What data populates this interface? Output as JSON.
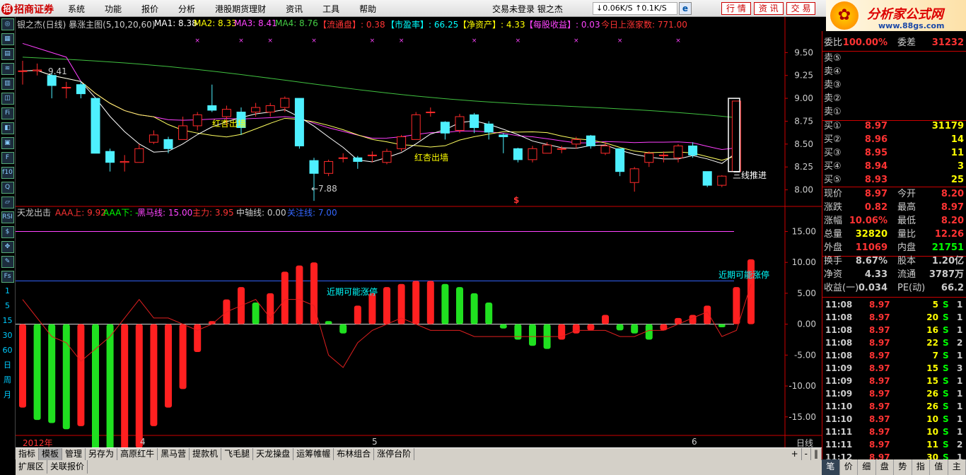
{
  "titlebar": {
    "app_name": "招商证券",
    "menu": [
      "系统",
      "功能",
      "报价",
      "分析",
      "港股期货理财",
      "资讯",
      "工具",
      "帮助"
    ],
    "status": "交易未登录  银之杰",
    "speed": "↓0.06K/S  ↑0.1K/S",
    "buttons": [
      "行 情",
      "资 讯",
      "交 易"
    ]
  },
  "brand": {
    "title": "分析家公式网",
    "url": "www.88gs.com"
  },
  "left_toolbar": [
    "◎",
    "▦",
    "▤",
    "≋",
    "▥",
    "◫",
    "Fi",
    "◧",
    "▣",
    "F",
    "f10",
    "Q",
    "▱",
    "RSI",
    "$",
    "✥",
    "✎",
    "Fs",
    "1",
    "5",
    "15",
    "30",
    "60",
    "日",
    "周",
    "月"
  ],
  "main_chart": {
    "header": {
      "name": "银之杰(日线)  暴涨主图(5,10,20,60)",
      "ma1": "MA1: 8.38",
      "ma2": "MA2: 8.33",
      "ma3": "MA3: 8.41",
      "ma4": "MA4: 8.76",
      "f1": "【流通盘】: 0.38",
      "f2": "【市盈率】: 66.25",
      "f3": "【净资产】: 4.33",
      "f4": "【每股收益】: 0.03",
      "f5": "今日上涨家数: 771.00"
    },
    "y_ticks": [
      "9.50",
      "9.25",
      "9.00",
      "8.75",
      "8.50",
      "8.25",
      "8.00"
    ],
    "annotations": {
      "high": "9.41",
      "low": "←7.88",
      "hx1": "红杏出墙",
      "hx2": "红杏出墙",
      "sxtj": "三线推进",
      "dollar": "$"
    },
    "colors": {
      "up": "#ff2a2a",
      "down": "#4ef0ff",
      "ma5": "#ffffff",
      "ma10": "#ffff60",
      "ma20": "#ff40ff",
      "ma60": "#40c040"
    }
  },
  "sub_chart": {
    "header": {
      "name": "天龙出击",
      "aaa_up": "AAA上: 9.92",
      "aaa_down": "AAA下: -",
      "hmx": "黑马线: 15.00",
      "zl": "主力: 3.95",
      "zzx": "中轴线: 0.00",
      "gzx": "关注线: 7.00"
    },
    "y_ticks": [
      "15.00",
      "10.00",
      "5.00",
      "0.00",
      "-5.00",
      "-10.00",
      "-15.00"
    ],
    "labels": {
      "a": "近期可能涨停",
      "b": "近期可能涨停"
    },
    "axis": {
      "year": "2012年",
      "m4": "4",
      "m5": "5",
      "m6": "6",
      "period": "日线"
    }
  },
  "chart_data": [
    {
      "type": "candlestick",
      "title": "银之杰(日线) 暴涨主图(5,10,20,60)",
      "ylim": [
        7.85,
        9.75
      ],
      "candles": [
        {
          "o": 9.3,
          "c": 9.3,
          "h": 9.41,
          "l": 9.15
        },
        {
          "o": 9.3,
          "c": 9.31,
          "h": 9.38,
          "l": 9.25
        },
        {
          "o": 9.25,
          "c": 9.14,
          "h": 9.28,
          "l": 9.0
        },
        {
          "o": 9.12,
          "c": 9.12,
          "h": 9.18,
          "l": 9.0
        },
        {
          "o": 9.15,
          "c": 9.05,
          "h": 9.18,
          "l": 9.0
        },
        {
          "o": 9.0,
          "c": 8.4,
          "h": 9.0,
          "l": 8.4
        },
        {
          "o": 8.42,
          "c": 8.3,
          "h": 8.45,
          "l": 8.2
        },
        {
          "o": 8.3,
          "c": 8.31,
          "h": 8.38,
          "l": 8.2
        },
        {
          "o": 8.3,
          "c": 8.45,
          "h": 8.5,
          "l": 8.3
        },
        {
          "o": 8.52,
          "c": 8.6,
          "h": 8.65,
          "l": 8.5
        },
        {
          "o": 8.55,
          "c": 8.45,
          "h": 8.58,
          "l": 8.4
        },
        {
          "o": 8.55,
          "c": 8.7,
          "h": 8.8,
          "l": 8.55
        },
        {
          "o": 8.7,
          "c": 8.82,
          "h": 8.85,
          "l": 8.65
        },
        {
          "o": 8.92,
          "c": 8.87,
          "h": 9.15,
          "l": 8.85
        },
        {
          "o": 8.8,
          "c": 8.88,
          "h": 8.92,
          "l": 8.7
        },
        {
          "o": 8.85,
          "c": 8.68,
          "h": 8.9,
          "l": 8.6
        },
        {
          "o": 8.85,
          "c": 8.9,
          "h": 8.95,
          "l": 8.8
        },
        {
          "o": 8.85,
          "c": 8.92,
          "h": 8.95,
          "l": 8.8
        },
        {
          "o": 8.9,
          "c": 9.0,
          "h": 9.02,
          "l": 8.85
        },
        {
          "o": 9.0,
          "c": 8.48,
          "h": 9.0,
          "l": 8.45
        },
        {
          "o": 8.32,
          "c": 8.18,
          "h": 8.35,
          "l": 7.88
        },
        {
          "o": 8.18,
          "c": 8.31,
          "h": 8.33,
          "l": 8.15
        },
        {
          "o": 8.35,
          "c": 8.35,
          "h": 8.4,
          "l": 8.3
        },
        {
          "o": 8.35,
          "c": 8.31,
          "h": 8.37,
          "l": 8.23
        },
        {
          "o": 8.38,
          "c": 8.38,
          "h": 8.42,
          "l": 8.3
        },
        {
          "o": 8.3,
          "c": 8.42,
          "h": 8.45,
          "l": 8.28
        },
        {
          "o": 8.45,
          "c": 8.58,
          "h": 8.6,
          "l": 8.42
        },
        {
          "o": 8.55,
          "c": 8.82,
          "h": 8.85,
          "l": 8.55
        },
        {
          "o": 8.85,
          "c": 8.85,
          "h": 8.9,
          "l": 8.8
        },
        {
          "o": 8.74,
          "c": 8.62,
          "h": 8.75,
          "l": 8.55
        },
        {
          "o": 8.65,
          "c": 8.8,
          "h": 8.83,
          "l": 8.62
        },
        {
          "o": 8.82,
          "c": 8.68,
          "h": 8.84,
          "l": 8.62
        },
        {
          "o": 8.72,
          "c": 8.63,
          "h": 8.75,
          "l": 8.55
        },
        {
          "o": 8.6,
          "c": 8.58,
          "h": 8.62,
          "l": 8.4
        },
        {
          "o": 8.45,
          "c": 8.33,
          "h": 8.46,
          "l": 8.3
        },
        {
          "o": 8.33,
          "c": 8.45,
          "h": 8.48,
          "l": 8.3
        },
        {
          "o": 8.4,
          "c": 8.49,
          "h": 8.52,
          "l": 8.4
        },
        {
          "o": 8.45,
          "c": 8.45,
          "h": 8.48,
          "l": 8.4
        },
        {
          "o": 8.5,
          "c": 8.55,
          "h": 8.58,
          "l": 8.45
        },
        {
          "o": 8.59,
          "c": 8.48,
          "h": 8.6,
          "l": 8.45
        },
        {
          "o": 8.4,
          "c": 8.48,
          "h": 8.52,
          "l": 8.38
        },
        {
          "o": 8.45,
          "c": 8.2,
          "h": 8.45,
          "l": 8.15
        },
        {
          "o": 8.08,
          "c": 8.23,
          "h": 8.25,
          "l": 7.98
        },
        {
          "o": 8.3,
          "c": 8.4,
          "h": 8.42,
          "l": 8.25
        },
        {
          "o": 8.38,
          "c": 8.38,
          "h": 8.42,
          "l": 8.3
        },
        {
          "o": 8.35,
          "c": 8.48,
          "h": 8.5,
          "l": 8.3
        },
        {
          "o": 8.48,
          "c": 8.38,
          "h": 8.52,
          "l": 8.35
        },
        {
          "o": 8.2,
          "c": 8.05,
          "h": 8.2,
          "l": 8.03
        },
        {
          "o": 8.05,
          "c": 8.15,
          "h": 8.16,
          "l": 8.03
        },
        {
          "o": 8.2,
          "c": 8.97,
          "h": 8.97,
          "l": 8.2
        }
      ]
    },
    {
      "type": "bar",
      "title": "天龙出击",
      "ylim": [
        -18,
        17
      ],
      "values": [
        -13.5,
        -15.5,
        -16,
        -17,
        -16.5,
        -23.5,
        -24,
        -23,
        -20,
        -16.5,
        -13.5,
        -10.5,
        -4.5,
        0.5,
        4,
        6,
        3.5,
        5,
        8.5,
        9.5,
        10,
        0.5,
        -1.5,
        3,
        5,
        6,
        6.5,
        7,
        7,
        6.5,
        6,
        5,
        3.5,
        -0.7,
        -2.5,
        -3.5,
        -4,
        -2.5,
        -1.5,
        -1,
        1.5,
        -1,
        -1.5,
        -2.5,
        -1,
        1,
        1.5,
        3,
        -0.5,
        6,
        10.5
      ],
      "line": [
        4,
        1,
        -2,
        -3,
        -6,
        -4,
        -2,
        1,
        4,
        1,
        1,
        0,
        -1,
        0,
        2,
        3,
        4,
        1,
        4,
        4,
        3,
        -5,
        -7,
        -3,
        -1,
        0,
        1,
        0,
        -1,
        -1,
        -1,
        -2,
        -2,
        -2,
        -2,
        -2,
        -2,
        -2,
        -1,
        -1,
        -1,
        -2,
        -2,
        -1,
        -1,
        0,
        1,
        2,
        -2,
        -1,
        6.5
      ],
      "series": [
        {
          "name": "黑马线",
          "value": 15
        },
        {
          "name": "关注线",
          "value": 7
        },
        {
          "name": "中轴线",
          "value": 0
        }
      ]
    }
  ],
  "quote": {
    "wb": {
      "label": "委比",
      "value": "100.00%",
      "label2": "委差",
      "value2": "31232"
    },
    "sells": [
      {
        "label": "卖⑤"
      },
      {
        "label": "卖④"
      },
      {
        "label": "卖③"
      },
      {
        "label": "卖②"
      },
      {
        "label": "卖①"
      }
    ],
    "buys": [
      {
        "label": "买①",
        "price": "8.97",
        "vol": "31179"
      },
      {
        "label": "买②",
        "price": "8.96",
        "vol": "14"
      },
      {
        "label": "买③",
        "price": "8.95",
        "vol": "11"
      },
      {
        "label": "买④",
        "price": "8.94",
        "vol": "3"
      },
      {
        "label": "买⑤",
        "price": "8.93",
        "vol": "25"
      }
    ],
    "stats": [
      {
        "k1": "现价",
        "v1": "8.97",
        "k2": "今开",
        "v2": "8.20"
      },
      {
        "k1": "涨跌",
        "v1": "0.82",
        "k2": "最高",
        "v2": "8.97"
      },
      {
        "k1": "涨幅",
        "v1": "10.06%",
        "k2": "最低",
        "v2": "8.20"
      },
      {
        "k1": "总量",
        "v1": "32820",
        "k2": "量比",
        "v2": "12.26"
      },
      {
        "k1": "外盘",
        "v1": "11069",
        "k2": "内盘",
        "v2": "21751"
      },
      {
        "k1": "换手",
        "v1": "8.67%",
        "k2": "股本",
        "v2": "1.20亿"
      },
      {
        "k1": "净资",
        "v1": "4.33",
        "k2": "流通",
        "v2": "3787万"
      },
      {
        "k1": "收益(一)",
        "v1": "0.034",
        "k2": "PE(动)",
        "v2": "66.2"
      }
    ],
    "ticks": [
      {
        "t": "11:08",
        "p": "8.97",
        "v": "5",
        "s": "S",
        "n": "1"
      },
      {
        "t": "11:08",
        "p": "8.97",
        "v": "20",
        "s": "S",
        "n": "1"
      },
      {
        "t": "11:08",
        "p": "8.97",
        "v": "16",
        "s": "S",
        "n": "1"
      },
      {
        "t": "11:08",
        "p": "8.97",
        "v": "22",
        "s": "S",
        "n": "2"
      },
      {
        "t": "11:08",
        "p": "8.97",
        "v": "7",
        "s": "S",
        "n": "1"
      },
      {
        "t": "11:09",
        "p": "8.97",
        "v": "15",
        "s": "S",
        "n": "3"
      },
      {
        "t": "11:09",
        "p": "8.97",
        "v": "15",
        "s": "S",
        "n": "1"
      },
      {
        "t": "11:09",
        "p": "8.97",
        "v": "26",
        "s": "S",
        "n": "1"
      },
      {
        "t": "11:10",
        "p": "8.97",
        "v": "26",
        "s": "S",
        "n": "1"
      },
      {
        "t": "11:10",
        "p": "8.97",
        "v": "10",
        "s": "S",
        "n": "1"
      },
      {
        "t": "11:11",
        "p": "8.97",
        "v": "10",
        "s": "S",
        "n": "1"
      },
      {
        "t": "11:11",
        "p": "8.97",
        "v": "11",
        "s": "S",
        "n": "2"
      },
      {
        "t": "11:12",
        "p": "8.97",
        "v": "30",
        "s": "S",
        "n": "1"
      }
    ],
    "bottom_tabs": [
      "笔",
      "价",
      "细",
      "盘",
      "势",
      "指",
      "值",
      "主"
    ]
  },
  "bottom_tabs": [
    "指标",
    "模板",
    "管理",
    "另存为",
    "高原红牛",
    "黑马营",
    "提款机",
    "飞毛腿",
    "天龙操盘",
    "运筹帷幄",
    "布林组合",
    "涨停台阶"
  ],
  "status_tabs": [
    "扩展区",
    "关联报价"
  ],
  "zoom_controls": [
    "+",
    "-",
    "‖"
  ]
}
